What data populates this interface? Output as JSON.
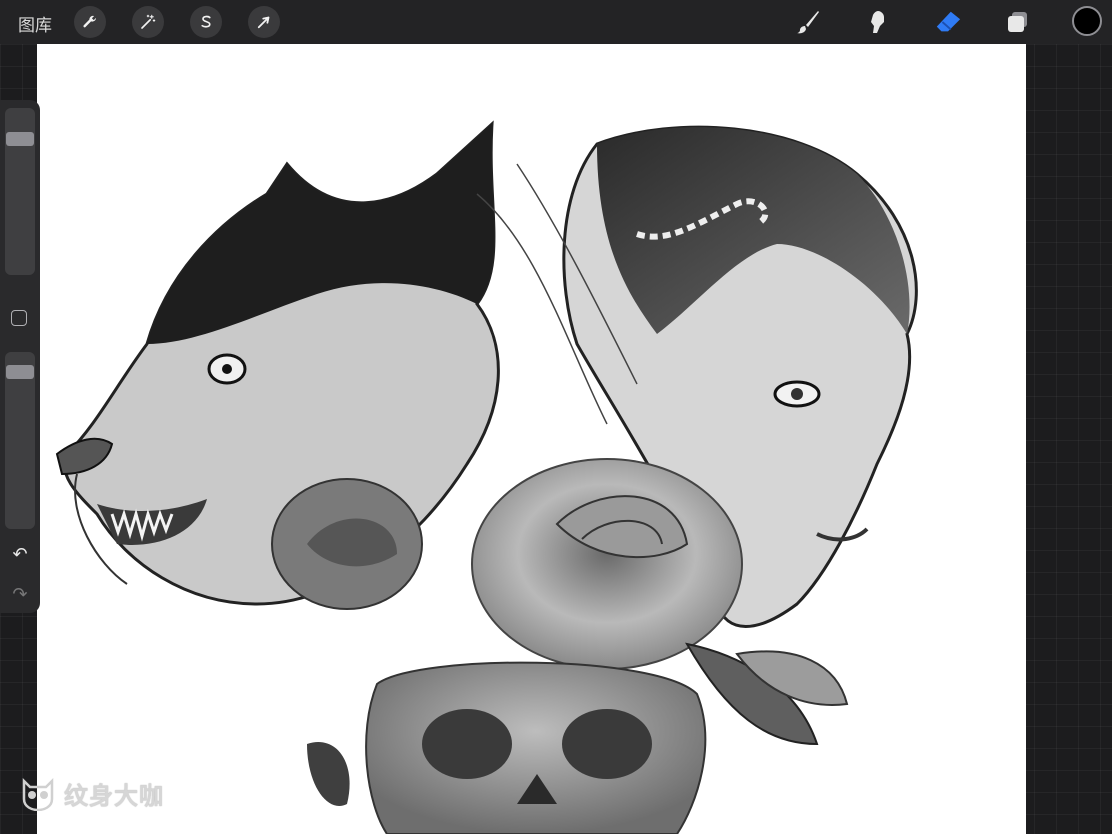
{
  "toolbar": {
    "gallery_label": "图库",
    "left_tools": [
      {
        "name": "actions-wrench-icon"
      },
      {
        "name": "adjustments-magic-wand-icon"
      },
      {
        "name": "selection-s-icon"
      },
      {
        "name": "transform-arrow-icon"
      }
    ],
    "right_tools": [
      {
        "name": "brush-icon"
      },
      {
        "name": "smudge-icon"
      },
      {
        "name": "eraser-icon",
        "active": true
      },
      {
        "name": "layers-icon"
      }
    ],
    "current_color": "#000000",
    "active_color": "#2f7bf5"
  },
  "sidebar": {
    "brush_size_level": 0.12,
    "opacity_level": 0.05
  },
  "watermark": {
    "text": "纹身大咖"
  }
}
